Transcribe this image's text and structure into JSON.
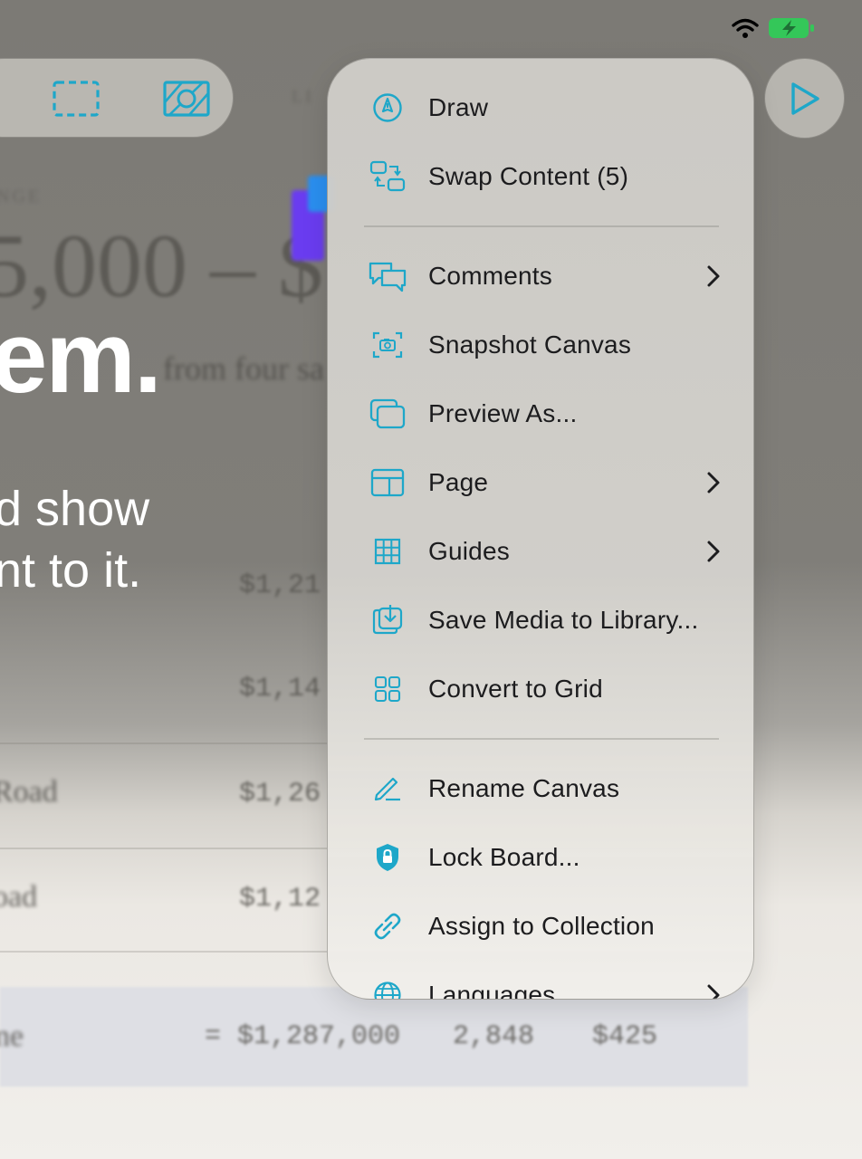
{
  "background": {
    "range_label": "NGE",
    "price_range": "5,000 – $",
    "hero_title": "em.",
    "hero_subtitle_line1": "d show",
    "hero_subtitle_line2": "nt to it.",
    "blurred_caption": "from four sa",
    "column_header": "LI",
    "rows": [
      {
        "name": "",
        "price": "$1,21"
      },
      {
        "name": "",
        "price": "$1,14"
      },
      {
        "name": "Road",
        "price": "$1,26"
      },
      {
        "name": "oad",
        "price": "$1,12"
      }
    ],
    "summary_row": {
      "name": "ne",
      "price": "= $1,287,000",
      "count": "2,848",
      "rate": "$425"
    }
  },
  "menu": {
    "items": [
      {
        "id": "draw",
        "label": "Draw",
        "icon": "pen-nib-icon",
        "submenu": false
      },
      {
        "id": "swap-content",
        "label": "Swap Content (5)",
        "icon": "swap-content-icon",
        "submenu": false
      },
      {
        "id": "comments",
        "label": "Comments",
        "icon": "comments-icon",
        "submenu": true
      },
      {
        "id": "snapshot-canvas",
        "label": "Snapshot Canvas",
        "icon": "camera-viewfinder-icon",
        "submenu": false
      },
      {
        "id": "preview-as",
        "label": "Preview As...",
        "icon": "stacked-windows-icon",
        "submenu": false
      },
      {
        "id": "page",
        "label": "Page",
        "icon": "page-layout-icon",
        "submenu": true
      },
      {
        "id": "guides",
        "label": "Guides",
        "icon": "grid-guides-icon",
        "submenu": true
      },
      {
        "id": "save-media",
        "label": "Save Media to Library...",
        "icon": "download-tray-icon",
        "submenu": false
      },
      {
        "id": "convert-grid",
        "label": "Convert to Grid",
        "icon": "four-squares-icon",
        "submenu": false
      },
      {
        "id": "rename-canvas",
        "label": "Rename Canvas",
        "icon": "pencil-line-icon",
        "submenu": false
      },
      {
        "id": "lock-board",
        "label": "Lock Board...",
        "icon": "lock-shield-icon",
        "submenu": false
      },
      {
        "id": "assign-collection",
        "label": "Assign to Collection",
        "icon": "link-icon",
        "submenu": false
      },
      {
        "id": "languages",
        "label": "Languages",
        "icon": "globe-icon",
        "submenu": true
      }
    ]
  },
  "colors": {
    "accent": "#1ea7c9",
    "battery": "#34c759",
    "menu_text": "#1c1c1e"
  }
}
